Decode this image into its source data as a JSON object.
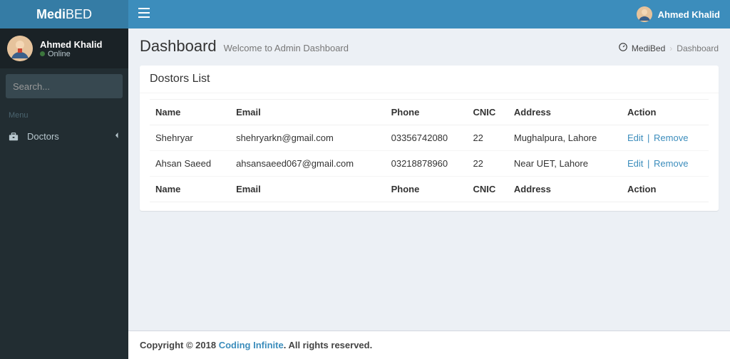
{
  "brand": {
    "bold": "Medi",
    "light": "BED"
  },
  "sidebar": {
    "user": {
      "name": "Ahmed Khalid",
      "status": "Online"
    },
    "search": {
      "placeholder": "Search..."
    },
    "menu_header": "Menu",
    "items": [
      {
        "label": "Doctors",
        "icon": "briefcase"
      }
    ]
  },
  "topbar": {
    "user": {
      "name": "Ahmed Khalid"
    }
  },
  "header": {
    "title": "Dashboard",
    "subtitle": "Welcome to Admin Dashboard"
  },
  "breadcrumb": {
    "root": "MediBed",
    "current": "Dashboard"
  },
  "box": {
    "title": "Dostors List"
  },
  "table": {
    "columns": [
      "Name",
      "Email",
      "Phone",
      "CNIC",
      "Address",
      "Action"
    ],
    "rows": [
      {
        "name": "Shehryar",
        "email": "shehryarkn@gmail.com",
        "phone": "03356742080",
        "cnic": "22",
        "address": "Mughalpura, Lahore"
      },
      {
        "name": "Ahsan Saeed",
        "email": "ahsansaeed067@gmail.com",
        "phone": "03218878960",
        "cnic": "22",
        "address": "Near UET, Lahore"
      }
    ],
    "actions": {
      "edit": "Edit",
      "remove": "Remove",
      "sep": "|"
    }
  },
  "footer": {
    "prefix": "Copyright © 2018 ",
    "link": "Coding Infinite",
    "suffix": ". All rights reserved."
  }
}
